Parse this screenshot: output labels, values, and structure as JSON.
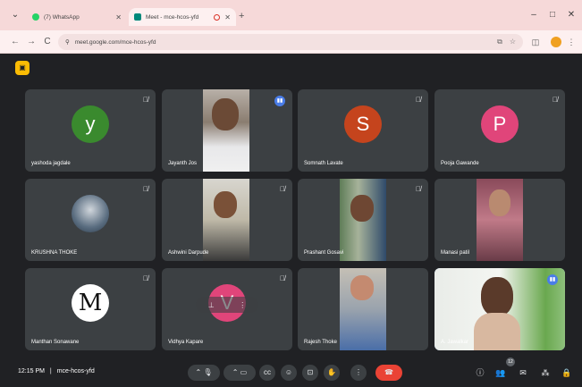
{
  "browser": {
    "tabs": [
      {
        "title": "(7) WhatsApp",
        "favicon_color": "#25d366"
      },
      {
        "title": "Meet - mce-hcos-yfd",
        "favicon_color": "#00897b"
      }
    ],
    "url": "meet.google.com/mce-hcos-yfd",
    "window_controls": [
      "–",
      "□",
      "✕"
    ],
    "new_tab": "+"
  },
  "meet": {
    "participants": [
      {
        "name": "yashoda jagdale",
        "type": "avatar",
        "initial": "y",
        "color": "#3a8a2e",
        "muted": true
      },
      {
        "name": "Jayanth Jos",
        "type": "video",
        "muted": false,
        "speaking": true
      },
      {
        "name": "Somnath Lavate",
        "type": "avatar",
        "initial": "S",
        "color": "#c5441d",
        "muted": true
      },
      {
        "name": "Pooja Gawande",
        "type": "avatar",
        "initial": "P",
        "color": "#e0457a",
        "muted": true
      },
      {
        "name": "KRUSHNA THOKE",
        "type": "photo",
        "muted": true
      },
      {
        "name": "Ashwini Darpude",
        "type": "video",
        "muted": true
      },
      {
        "name": "Prashant Gosavi",
        "type": "video",
        "muted": true
      },
      {
        "name": "Manasi patil",
        "type": "video",
        "muted": false
      },
      {
        "name": "Manthan Sonawane",
        "type": "logo",
        "muted": true
      },
      {
        "name": "Vidhya Kapare",
        "type": "avatar",
        "initial": "V",
        "color": "#e0457a",
        "muted": true
      },
      {
        "name": "Rajesh Thoke",
        "type": "video",
        "muted": false
      },
      {
        "name": "A. Jawalkar",
        "type": "video",
        "muted": false,
        "self": true
      }
    ]
  },
  "bottombar": {
    "time": "12:15 PM",
    "separator": "|",
    "meeting_code": "mce-hcos-yfd",
    "participant_count": "12"
  }
}
